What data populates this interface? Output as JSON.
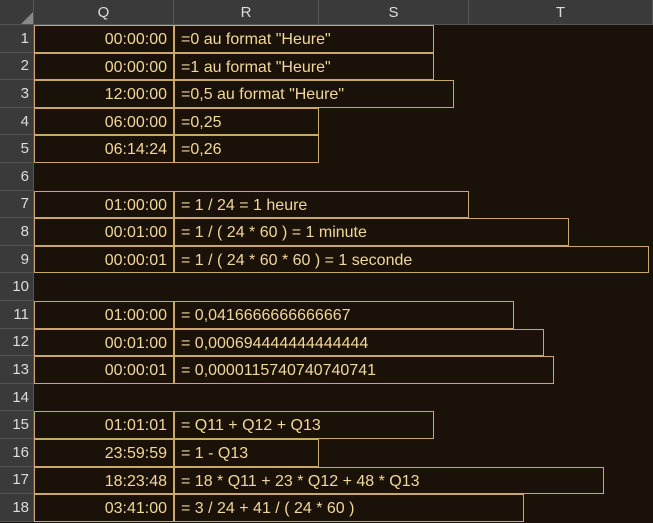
{
  "columns": [
    "Q",
    "R",
    "S",
    "T"
  ],
  "rowCount": 18,
  "rows": [
    {
      "q": "00:00:00",
      "r": "=0 au format \"Heure\"",
      "rWidth": 260
    },
    {
      "q": "00:00:00",
      "r": "=1 au format \"Heure\"",
      "rWidth": 260
    },
    {
      "q": "12:00:00",
      "r": "=0,5 au format \"Heure\"",
      "rWidth": 280
    },
    {
      "q": "06:00:00",
      "r": "=0,25",
      "rWidth": 145
    },
    {
      "q": "06:14:24",
      "r": "=0,26",
      "rWidth": 145
    },
    {
      "q": "",
      "r": "",
      "rWidth": 0
    },
    {
      "q": "01:00:00",
      "r": "= 1 / 24 = 1 heure",
      "rWidth": 295
    },
    {
      "q": "00:01:00",
      "r": "= 1 / ( 24 * 60 ) = 1 minute",
      "rWidth": 395
    },
    {
      "q": "00:00:01",
      "r": "= 1 / ( 24 * 60 * 60 ) = 1 seconde",
      "rWidth": 475
    },
    {
      "q": "",
      "r": "",
      "rWidth": 0
    },
    {
      "q": "01:00:00",
      "r": "= 0,0416666666666667",
      "rWidth": 340
    },
    {
      "q": "00:01:00",
      "r": "= 0,000694444444444444",
      "rWidth": 370
    },
    {
      "q": "00:00:01",
      "r": "= 0,0000115740740740741",
      "rWidth": 380
    },
    {
      "q": "",
      "r": "",
      "rWidth": 0
    },
    {
      "q": "01:01:01",
      "r": "= Q11 + Q12 + Q13",
      "rWidth": 260
    },
    {
      "q": "23:59:59",
      "r": "= 1 - Q13",
      "rWidth": 145
    },
    {
      "q": "18:23:48",
      "r": "= 18 * Q11 + 23 * Q12 + 48 * Q13",
      "rWidth": 430
    },
    {
      "q": "03:41:00",
      "r": "= 3 / 24 + 41 / ( 24 * 60 )",
      "rWidth": 350
    }
  ]
}
